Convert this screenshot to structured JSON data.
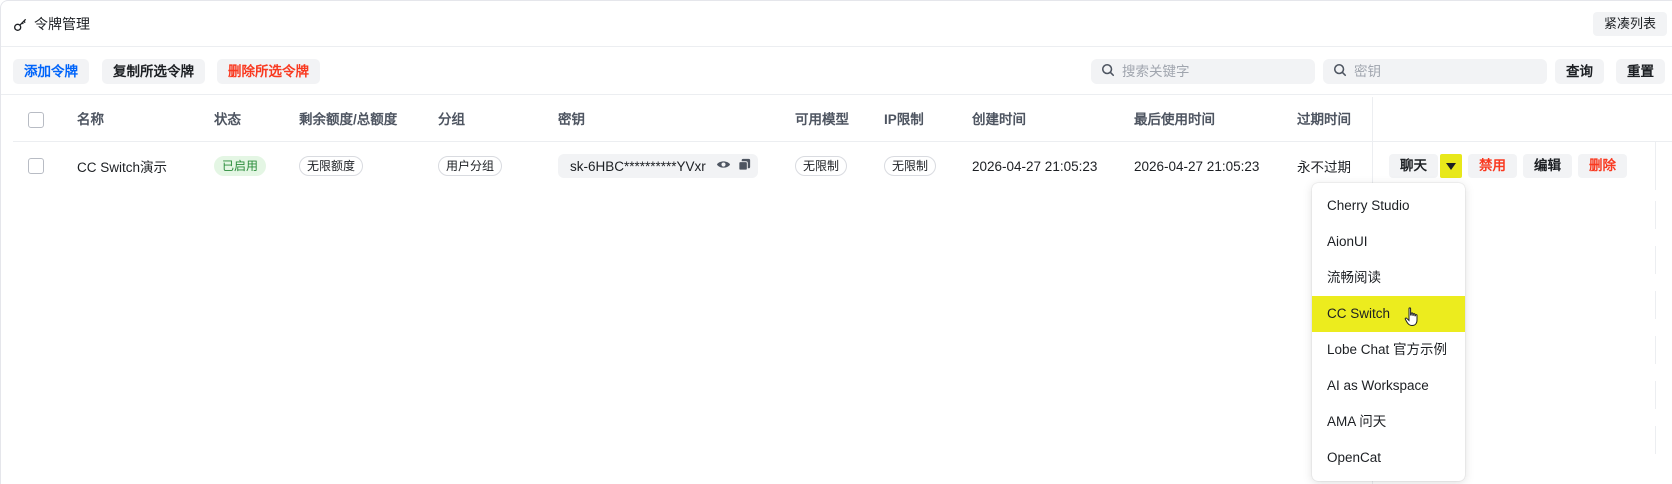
{
  "header": {
    "title": "令牌管理",
    "compact_label": "紧凑列表"
  },
  "toolbar": {
    "add_label": "添加令牌",
    "copy_label": "复制所选令牌",
    "delete_label": "删除所选令牌",
    "keyword_placeholder": "搜索关键字",
    "token_placeholder": "密钥",
    "query_label": "查询",
    "reset_label": "重置"
  },
  "table": {
    "columns": [
      "名称",
      "状态",
      "剩余额度/总额度",
      "分组",
      "密钥",
      "可用模型",
      "IP限制",
      "创建时间",
      "最后使用时间",
      "过期时间"
    ],
    "rows": [
      {
        "name": "CC Switch演示",
        "status": "已启用",
        "quota": "无限额度",
        "group": "用户分组",
        "key": "sk-6HBC**********YVxr",
        "models": "无限制",
        "ip_limit": "无限制",
        "created": "2026-04-27 21:05:23",
        "last_used": "2026-04-27 21:05:23",
        "expires": "永不过期",
        "actions": {
          "chat": "聊天",
          "disable": "禁用",
          "edit": "编辑",
          "delete": "删除"
        }
      }
    ]
  },
  "dropdown": {
    "items": [
      "Cherry Studio",
      "AionUI",
      "流畅阅读",
      "CC Switch",
      "Lobe Chat 官方示例",
      "AI as Workspace",
      "AMA 问天",
      "OpenCat"
    ],
    "active": "CC Switch"
  },
  "colors": {
    "primary": "#0064fa",
    "danger": "#f93920",
    "success_bg": "#e4f6e4",
    "highlight": "#ecec1e"
  }
}
